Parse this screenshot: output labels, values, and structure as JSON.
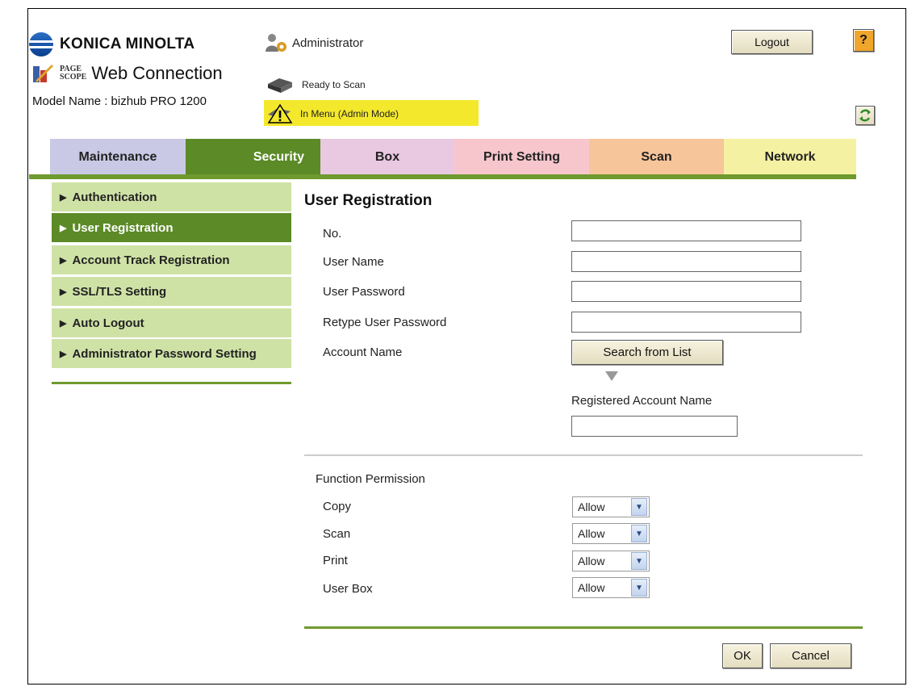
{
  "brand": {
    "logo_text": "KONICA MINOLTA",
    "pagescope_small_1": "PAGE",
    "pagescope_small_2": "SCOPE",
    "pagescope_title": "Web Connection"
  },
  "header": {
    "user_role": "Administrator",
    "logout_label": "Logout",
    "help_label": "?",
    "model_name": "Model Name : bizhub PRO 1200",
    "status_scan": "Ready to Scan",
    "status_menu": "In Menu (Admin Mode)"
  },
  "tabs": [
    {
      "label": "Maintenance",
      "color": "#c9c9e6"
    },
    {
      "label": "Security",
      "color": "#5b8a26",
      "active": true
    },
    {
      "label": "Box",
      "color": "#e9c8e1"
    },
    {
      "label": "Print Setting",
      "color": "#f7c6cd"
    },
    {
      "label": "Scan",
      "color": "#f6c59a"
    },
    {
      "label": "Network",
      "color": "#f5f1a2"
    }
  ],
  "sidebar": {
    "items": [
      {
        "label": "Authentication"
      },
      {
        "label": "User Registration",
        "active": true
      },
      {
        "label": "Account Track Registration"
      },
      {
        "label": "SSL/TLS Setting"
      },
      {
        "label": "Auto Logout"
      },
      {
        "label": "Administrator Password Setting"
      }
    ]
  },
  "form": {
    "title": "User Registration",
    "fields": [
      {
        "label": "No.",
        "value": ""
      },
      {
        "label": "User Name",
        "value": ""
      },
      {
        "label": "User Password",
        "value": ""
      },
      {
        "label": "Retype User Password",
        "value": ""
      }
    ],
    "account_name_label": "Account Name",
    "search_button": "Search from List",
    "registered_account_label": "Registered Account Name",
    "registered_account_value": "",
    "function_permission_label": "Function Permission",
    "permissions": [
      {
        "label": "Copy",
        "value": "Allow"
      },
      {
        "label": "Scan",
        "value": "Allow"
      },
      {
        "label": "Print",
        "value": "Allow"
      },
      {
        "label": "User Box",
        "value": "Allow"
      }
    ],
    "ok_label": "OK",
    "cancel_label": "Cancel"
  },
  "colors": {
    "accent_green": "#6f9a2e",
    "sidebar_bg": "#cfe2a6",
    "status_yellow": "#f4e82c"
  }
}
